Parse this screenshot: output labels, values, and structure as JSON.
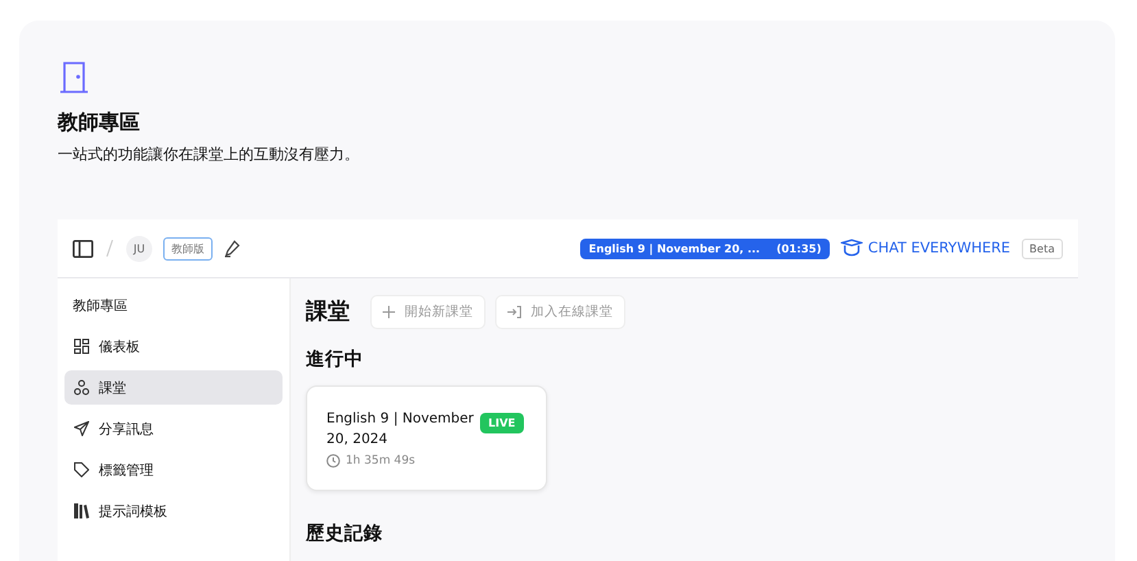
{
  "header": {
    "title": "教師專區",
    "subtitle": "一站式的功能讓你在課堂上的互動沒有壓力。"
  },
  "topbar": {
    "avatar": "JU",
    "badge": "教師版",
    "session": {
      "name": "English 9 | November 20, ...",
      "time": "(01:35)"
    },
    "brand": "CHAT EVERYWHERE",
    "beta": "Beta"
  },
  "sidebar": {
    "heading": "教師專區",
    "items": [
      {
        "label": "儀表板",
        "kind": "dashboard",
        "selected": false
      },
      {
        "label": "課堂",
        "kind": "classroom",
        "selected": true
      },
      {
        "label": "分享訊息",
        "kind": "share",
        "selected": false
      },
      {
        "label": "標籤管理",
        "kind": "tag",
        "selected": false
      },
      {
        "label": "提示詞模板",
        "kind": "library",
        "selected": false
      }
    ]
  },
  "main": {
    "title": "課堂",
    "buttons": [
      {
        "label": "開始新課堂",
        "kind": "plus"
      },
      {
        "label": "加入在線課堂",
        "kind": "join"
      }
    ],
    "ongoing": {
      "heading": "進行中",
      "cards": [
        {
          "title": "English 9 | November 20, 2024",
          "status": "LIVE",
          "duration": "1h 35m 49s"
        }
      ]
    },
    "history": {
      "heading": "歷史記錄"
    }
  }
}
